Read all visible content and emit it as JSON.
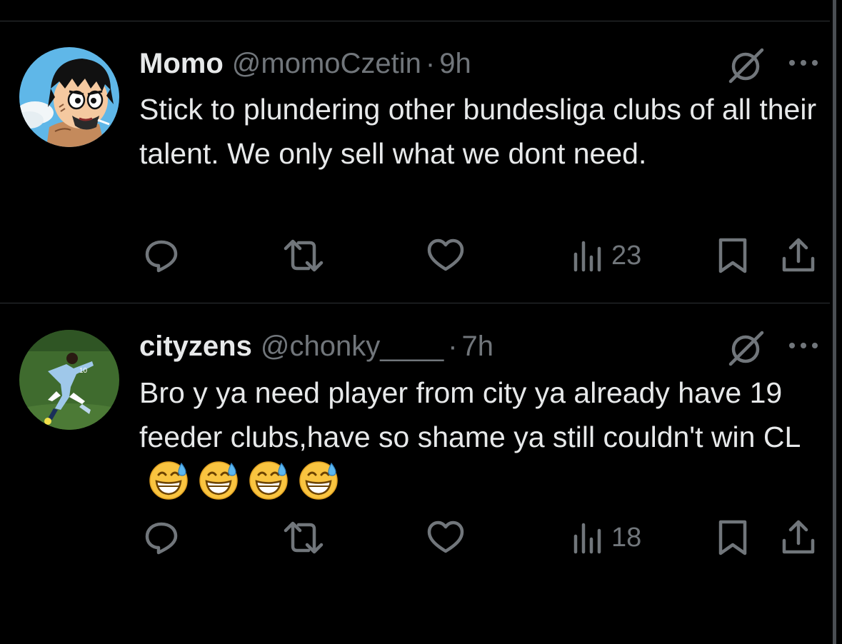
{
  "colors": {
    "background": "#000000",
    "text_primary": "#e7e9ea",
    "text_secondary": "#71767b",
    "divider": "#2f3336"
  },
  "tweets": [
    {
      "display_name": "Momo",
      "handle": "@momoCzetin",
      "separator": "·",
      "time": "9h",
      "text": "Stick to plundering other bundesliga clubs of all their talent. We only sell what we dont need.",
      "emojis": [],
      "views": "23",
      "avatar": "anime-character-avatar",
      "icons": [
        "reply-icon",
        "retweet-icon",
        "like-icon",
        "views-icon",
        "bookmark-icon",
        "share-icon",
        "grok-icon",
        "more-icon"
      ]
    },
    {
      "display_name": "cityzens",
      "handle": "@chonky____",
      "separator": "·",
      "time": "7h",
      "text": "Bro y ya need player from city ya already have 19 feeder clubs,have so shame  ya still couldn't win CL",
      "emojis": [
        "grinning-face-with-sweat",
        "grinning-face-with-sweat",
        "grinning-face-with-sweat",
        "grinning-face-with-sweat"
      ],
      "views": "18",
      "avatar": "football-player-avatar",
      "icons": [
        "reply-icon",
        "retweet-icon",
        "like-icon",
        "views-icon",
        "bookmark-icon",
        "share-icon",
        "grok-icon",
        "more-icon"
      ]
    }
  ]
}
